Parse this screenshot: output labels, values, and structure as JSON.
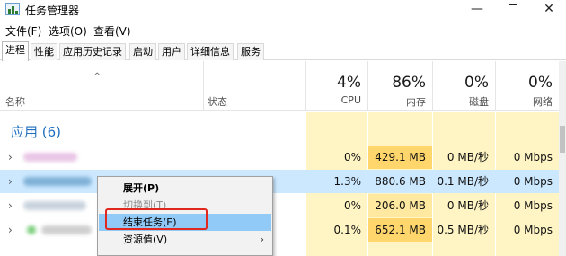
{
  "window": {
    "title": "任务管理器",
    "minimize": "—",
    "close": "✕"
  },
  "menubar": [
    "文件(F)",
    "选项(O)",
    "查看(V)"
  ],
  "tabs": [
    "进程",
    "性能",
    "应用历史记录",
    "启动",
    "用户",
    "详细信息",
    "服务"
  ],
  "active_tab": "进程",
  "columns": {
    "sort_indicator": "^",
    "name": "名称",
    "status": "状态",
    "cpu": {
      "pct": "4%",
      "label": "CPU"
    },
    "memory": {
      "pct": "86%",
      "label": "内存"
    },
    "disk": {
      "pct": "0%",
      "label": "磁盘"
    },
    "network": {
      "pct": "0%",
      "label": "网络"
    }
  },
  "group": {
    "title": "应用 (6)"
  },
  "rows": [
    {
      "cpu": "0%",
      "memory": "429.1 MB",
      "disk": "0 MB/秒",
      "network": "0 Mbps",
      "selected": false
    },
    {
      "cpu": "1.3%",
      "memory": "880.6 MB",
      "disk": "0.1 MB/秒",
      "network": "0 Mbps",
      "selected": true
    },
    {
      "cpu": "0%",
      "memory": "206.0 MB",
      "disk": "0 MB/秒",
      "network": "0 Mbps",
      "selected": false
    },
    {
      "cpu": "0.1%",
      "memory": "652.1 MB",
      "disk": "0.5 MB/秒",
      "network": "0 Mbps",
      "selected": false
    }
  ],
  "context_menu": {
    "expand": "展开(P)",
    "switch_to": "切换到(T)",
    "end_task": "结束任务(E)",
    "resource_values": "资源值(V)",
    "submenu_arrow": "›"
  },
  "colors": {
    "accent_blue": "#1f6fbf",
    "selected_row": "#cce8ff",
    "highlight_item": "#91c9f7",
    "annotation_red": "#e0281e",
    "usage_light": "#fff4c4",
    "usage_medium": "#ffe8a0",
    "usage_heavy": "#ffd66b"
  }
}
